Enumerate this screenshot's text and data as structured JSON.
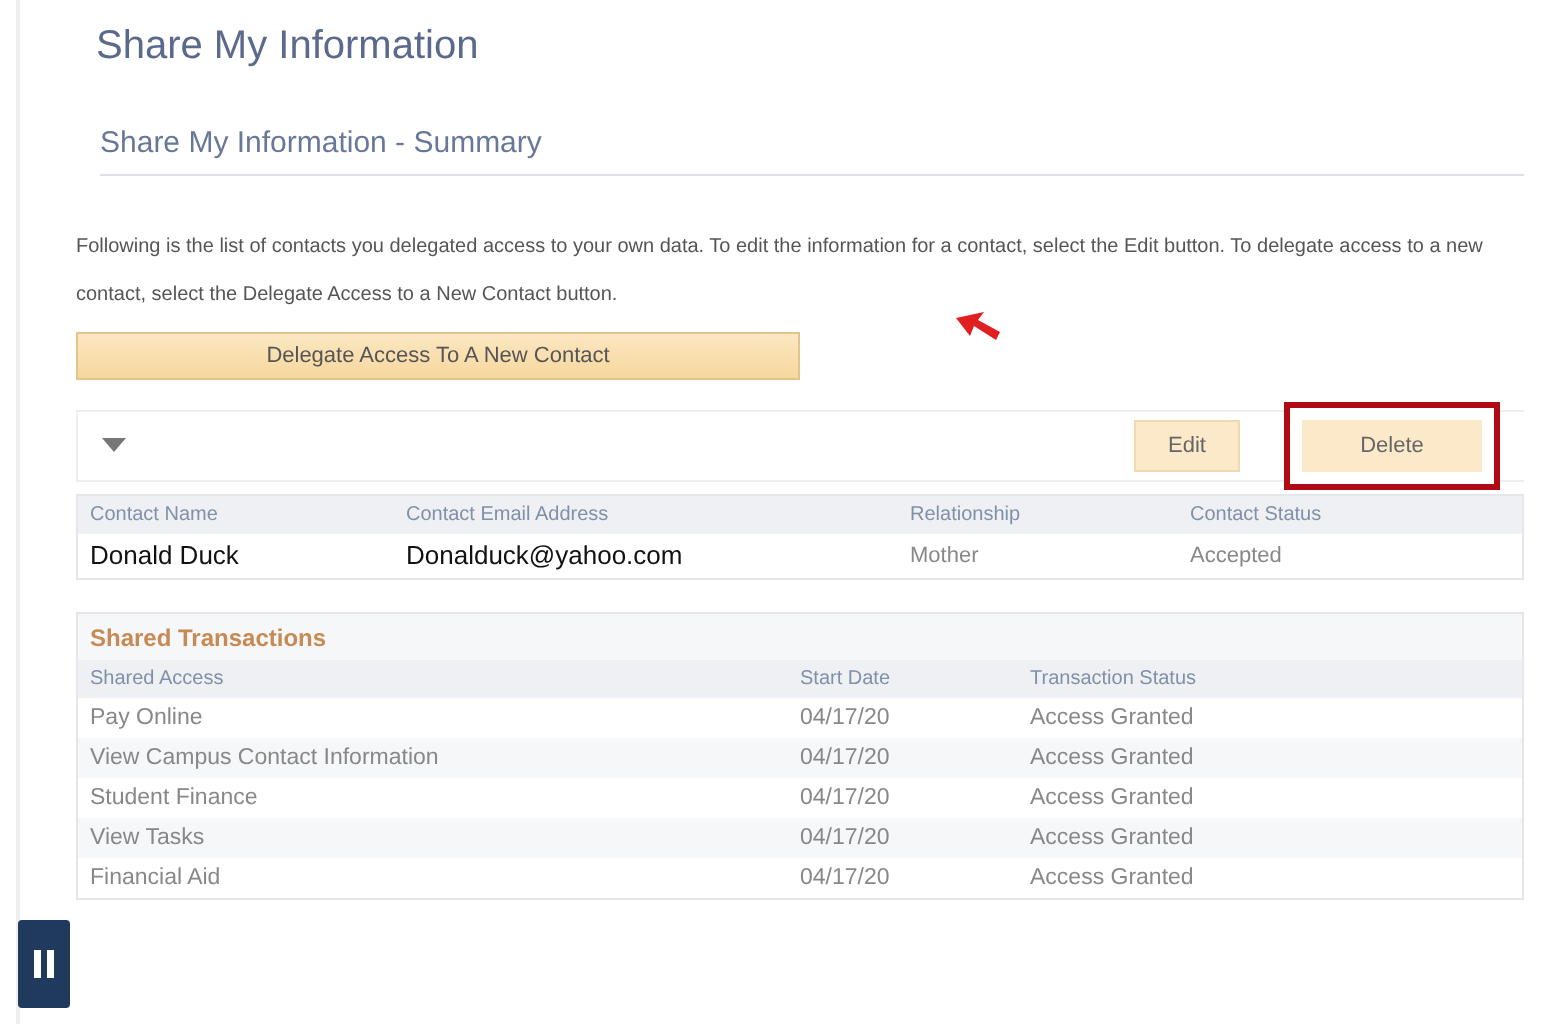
{
  "page_title": "Share My Information",
  "section_title": "Share My Information - Summary",
  "instructions": "Following is the list of contacts you delegated access to your own data. To edit the information for a contact, select the Edit button. To delegate access to a new contact, select the Delegate Access to a New Contact button.",
  "delegate_button": "Delegate Access To A New Contact",
  "toolbar": {
    "expanded": true,
    "buttons": [
      {
        "label": "Edit",
        "highlighted": false
      },
      {
        "label": "Delete",
        "highlighted": true
      }
    ]
  },
  "contacts": {
    "columns": [
      "Contact Name",
      "Contact Email Address",
      "Relationship",
      "Contact Status"
    ],
    "rows": [
      [
        "Donald Duck",
        "Donalduck@yahoo.com",
        "Mother",
        "Accepted"
      ]
    ]
  },
  "shared_transactions": {
    "title": "Shared Transactions",
    "columns": [
      "Shared Access",
      "Start Date",
      "Transaction Status"
    ],
    "rows": [
      [
        "Pay Online",
        "04/17/20",
        "Access Granted"
      ],
      [
        "View Campus Contact Information",
        "04/17/20",
        "Access Granted"
      ],
      [
        "Student Finance",
        "04/17/20",
        "Access Granted"
      ],
      [
        "View Tasks",
        "04/17/20",
        "Access Granted"
      ],
      [
        "Financial Aid",
        "04/17/20",
        "Access Granted"
      ]
    ]
  }
}
